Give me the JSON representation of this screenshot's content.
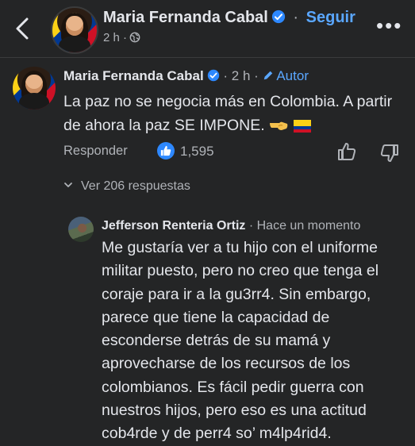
{
  "header": {
    "author_name": "Maria Fernanda Cabal",
    "separator": "·",
    "follow_label": "Seguir",
    "time": "2 h ·",
    "more_label": "•••",
    "back_icon": "chevron-left-icon",
    "privacy_icon": "globe-icon"
  },
  "comment": {
    "author_name": "Maria Fernanda Cabal",
    "time": "· 2 h ·",
    "author_badge": "Autor",
    "text": "La paz no se negocia más en Colombia. A partir de ahora la paz SE IMPONE.",
    "emojis": [
      "pointing-hand-emoji",
      "colombia-flag-emoji"
    ],
    "reply_label": "Responder",
    "reaction_count": "1,595",
    "replies_toggle": "Ver 206 respuestas",
    "accent_color": "#2d88ff"
  },
  "reply": {
    "author_name": "Jefferson Renteria Ortiz",
    "time": "· Hace un momento",
    "text": "Me gustaría ver a tu hijo con el uniforme militar puesto, pero no creo que tenga el coraje para ir a la gu3rr4. Sin embargo, parece que tiene la capacidad de esconderse detrás de su mamá y aprovecharse de los recursos de los colombianos. Es fácil pedir guerra con nuestros hijos, pero eso es una actitud cob4rde y de perr4 so’ m4lp4rid4."
  }
}
